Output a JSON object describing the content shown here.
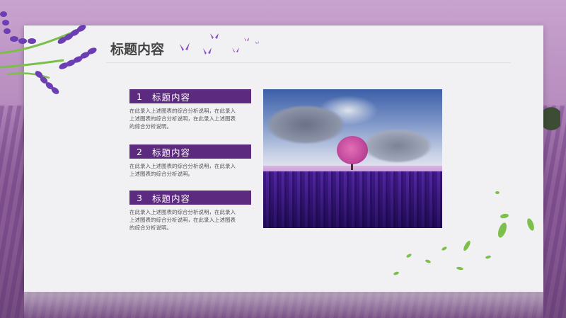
{
  "slide": {
    "title": "标题内容",
    "sections": [
      {
        "number": "1",
        "heading": "标题内容",
        "body_lines": [
          "在此录入上述图表的综合分析说明，在此录入",
          "上述图表的综合分析说明，在此录入上述图表",
          "的综合分析说明。"
        ]
      },
      {
        "number": "2",
        "heading": "标题内容",
        "body_lines": [
          "在此录入上述图表的综合分析说明，在此录入",
          "上述图表的综合分析说明。"
        ]
      },
      {
        "number": "3",
        "heading": "标题内容",
        "body_lines": [
          "在此录入上述图表的综合分析说明，在此录入",
          "上述图表的综合分析说明，在此录入上述图表",
          "的综合分析说明。"
        ]
      }
    ]
  },
  "colors": {
    "accent": "#5c2a7e",
    "card": "#f1f0f2"
  }
}
